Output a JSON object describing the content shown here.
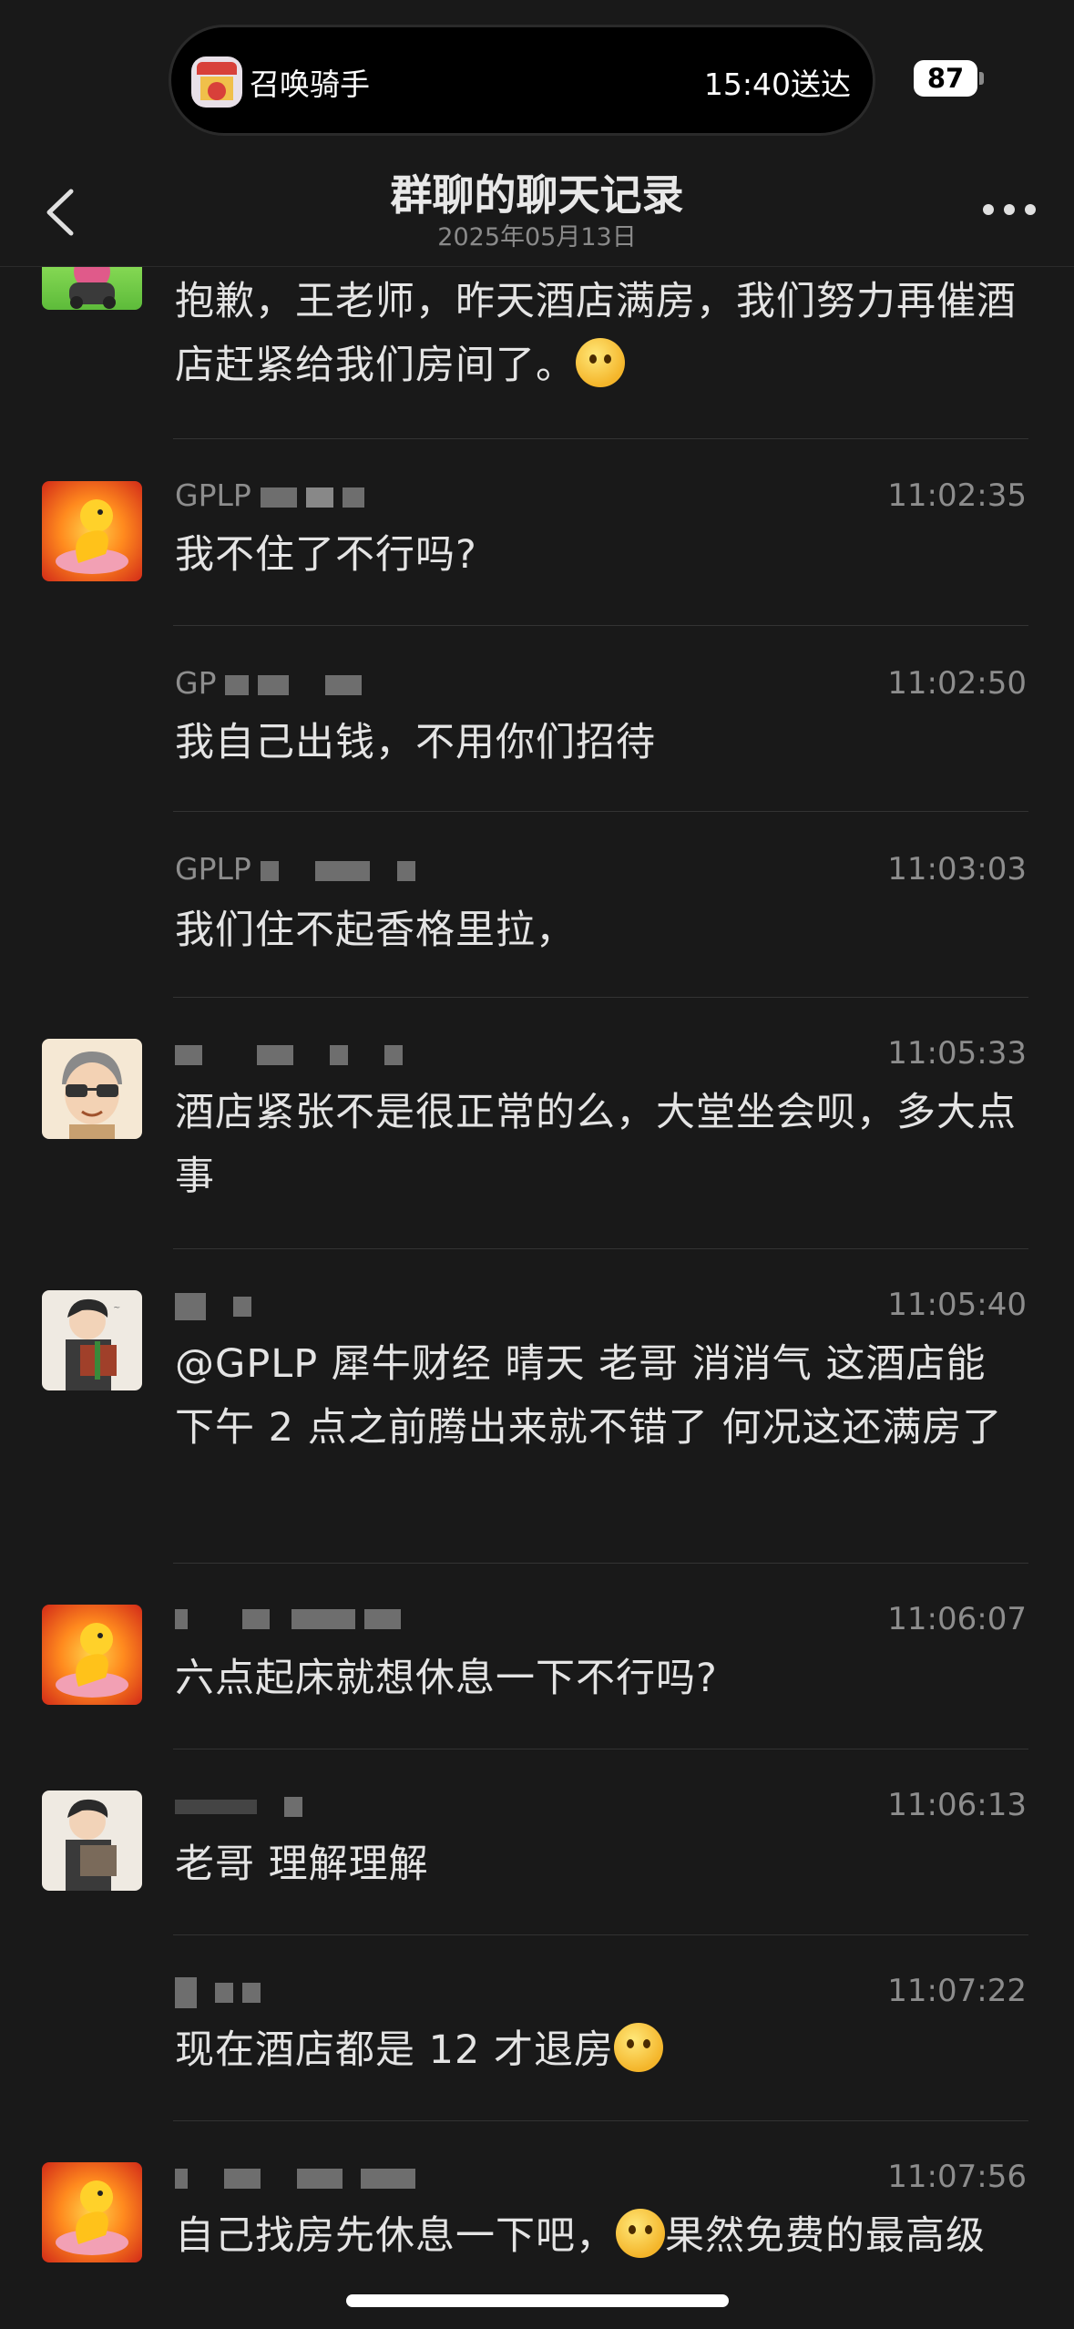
{
  "status": {
    "activity_label": "召唤骑手",
    "eta": "15:40送达",
    "battery": "87"
  },
  "header": {
    "title": "群聊的聊天记录",
    "date": "2025年05月13日"
  },
  "messages": [
    {
      "name": "",
      "time": "",
      "text": "抱歉，王老师，昨天酒店满房，我们努力再催酒店赶紧给我们房间了。",
      "avatar": "green-cartoon",
      "emoji": "pleading"
    },
    {
      "name": "GPLP",
      "time": "11:02:35",
      "text": "我不住了不行吗?",
      "avatar": "golden-snake"
    },
    {
      "name": "GP",
      "time": "11:02:50",
      "text": "我自己出钱，不用你们招待",
      "avatar": ""
    },
    {
      "name": "GPLP",
      "time": "11:03:03",
      "text": "我们住不起香格里拉，",
      "avatar": ""
    },
    {
      "name": "",
      "time": "11:05:33",
      "text": "酒店紧张不是很正常的么，大堂坐会呗，多大点事",
      "avatar": "man-sunglasses"
    },
    {
      "name": "",
      "time": "11:05:40",
      "text": "@GPLP 犀牛财经 晴天 老哥 消消气 这酒店能下午 2 点之前腾出来就不错了 何况这还满房了",
      "avatar": "boy-gift"
    },
    {
      "name": "",
      "time": "11:06:07",
      "text": "六点起床就想休息一下不行吗?",
      "avatar": "golden-snake"
    },
    {
      "name": "",
      "time": "11:06:13",
      "text": "老哥 理解理解",
      "avatar": "boy-gift"
    },
    {
      "name": "",
      "time": "11:07:22",
      "text": "现在酒店都是 12 才退房",
      "avatar": "",
      "emoji": "crying"
    },
    {
      "name": "",
      "time": "11:07:56",
      "text_before": "自己找房先休息一下吧，",
      "text_after": "果然免费的最高级",
      "avatar": "golden-snake",
      "emoji": "crying"
    }
  ],
  "icons": {
    "back": "chevron-left-icon",
    "more": "more-dots-icon"
  }
}
